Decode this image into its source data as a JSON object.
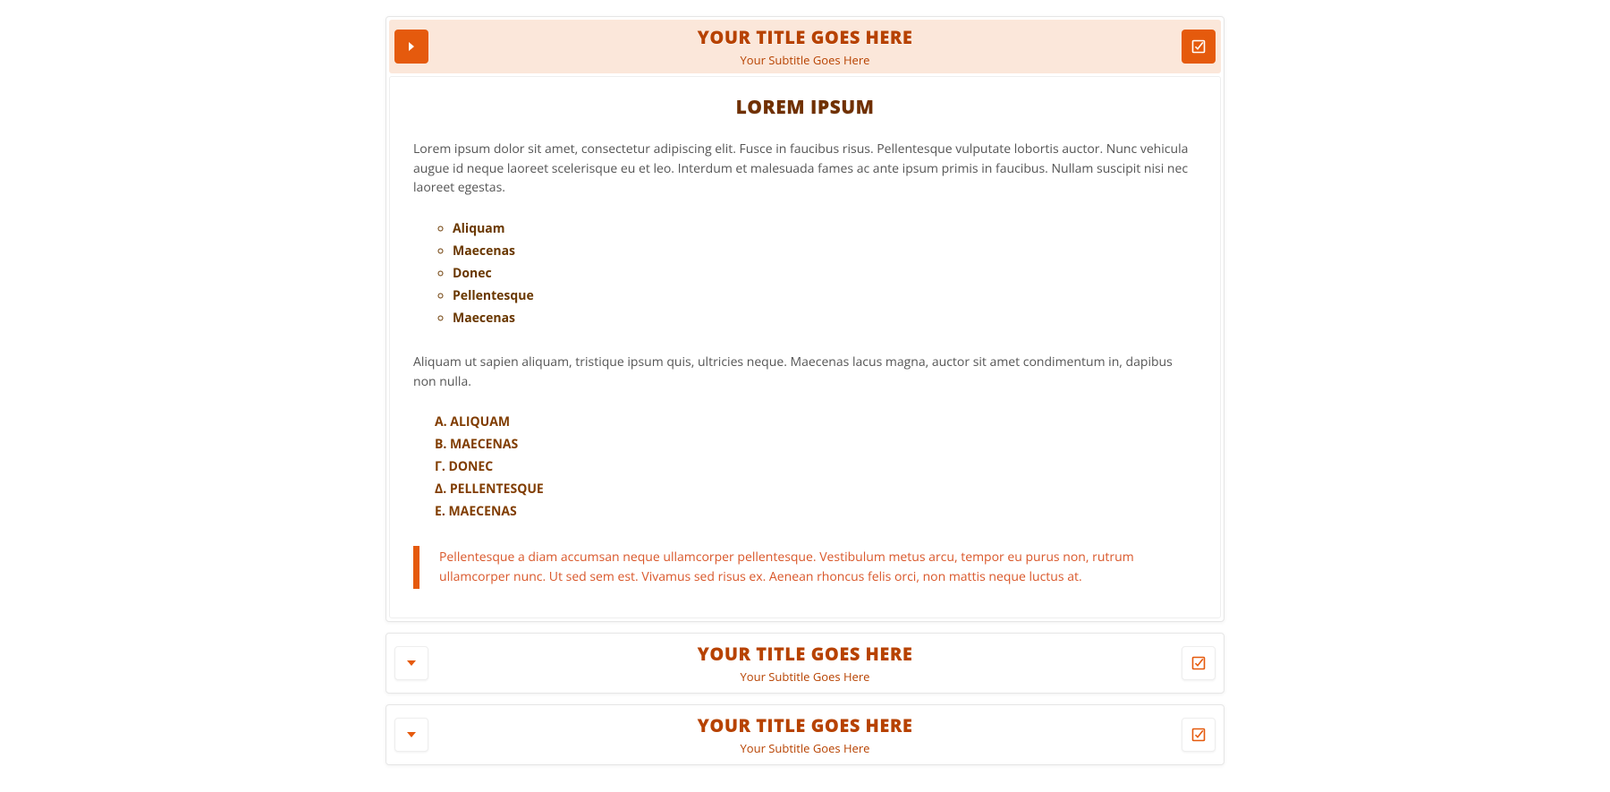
{
  "colors": {
    "accent": "#e55a0d",
    "title_text": "#b74200",
    "body_heading": "#703000",
    "list_text": "#6a3800",
    "quote_text": "#d9572a"
  },
  "panels": [
    {
      "expanded": true,
      "title": "YOUR TITLE GOES HERE",
      "subtitle": "Your Subtitle Goes Here",
      "body": {
        "heading": "LOREM IPSUM",
        "para1": "Lorem ipsum dolor sit amet, consectetur adipiscing elit. Fusce in faucibus risus. Pellentesque vulputate lobortis auctor. Nunc vehicula augue id neque laoreet scelerisque eu et leo. Interdum et malesuada fames ac ante ipsum primis in faucibus. Nullam suscipit nisi nec laoreet egestas.",
        "list1": [
          "Aliquam",
          "Maecenas",
          "Donec",
          "Pellentesque",
          "Maecenas"
        ],
        "para2": "Aliquam ut sapien aliquam, tristique ipsum quis, ultricies neque. Maecenas lacus magna, auctor sit amet condimentum in, dapibus non nulla.",
        "list2_markers": [
          "α.",
          "β.",
          "γ.",
          "δ.",
          "ε."
        ],
        "list2": [
          "ALIQUAM",
          "MAECENAS",
          "DONEC",
          "PELLENTESQUE",
          "MAECENAS"
        ],
        "quote": "Pellentesque a diam accumsan neque ullamcorper pellentesque. Vestibulum metus arcu, tempor eu purus non, rutrum ullamcorper nunc. Ut sed sem est. Vivamus sed risus ex. Aenean rhoncus felis orci, non mattis neque luctus at."
      }
    },
    {
      "expanded": false,
      "title": "YOUR TITLE GOES HERE",
      "subtitle": "Your Subtitle Goes Here"
    },
    {
      "expanded": false,
      "title": "YOUR TITLE GOES HERE",
      "subtitle": "Your Subtitle Goes Here"
    }
  ]
}
